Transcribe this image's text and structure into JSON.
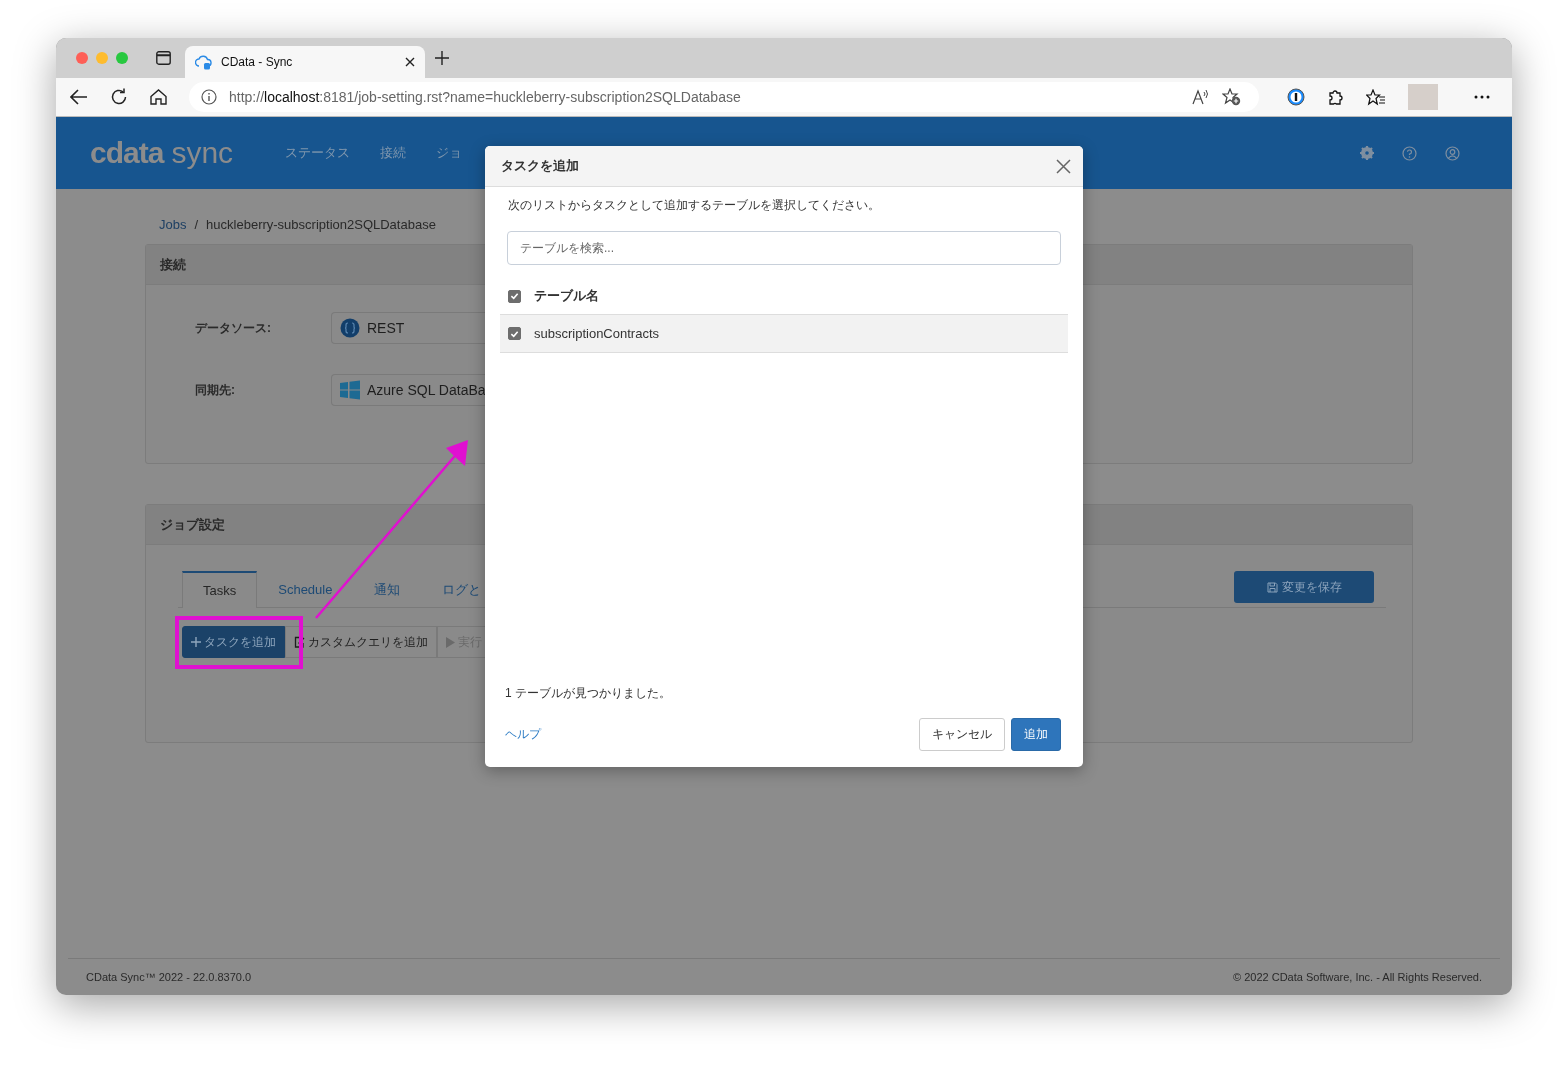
{
  "browser": {
    "tab_title": "CData - Sync",
    "url_scheme": "http://",
    "url_host": "localhost",
    "url_path": ":8181/job-setting.rst?name=huckleberry-subscription2SQLDatabase"
  },
  "app_header": {
    "logo_mark": "cdata",
    "logo_word": "sync",
    "nav": [
      {
        "label": "ステータス"
      },
      {
        "label": "接続"
      },
      {
        "label": "ジョ"
      }
    ]
  },
  "breadcrumb": {
    "link": "Jobs",
    "separator": "/",
    "current": "huckleberry-subscription2SQLDatabase"
  },
  "connection_panel": {
    "title": "接続",
    "fields": [
      {
        "label": "データソース:",
        "value": "REST",
        "kind": "rest"
      },
      {
        "label": "同期先:",
        "value": "Azure SQL DataBa",
        "kind": "windows"
      }
    ]
  },
  "job_panel": {
    "title": "ジョブ設定",
    "tabs": [
      {
        "label": "Tasks",
        "selected": true
      },
      {
        "label": "Schedule",
        "selected": false
      },
      {
        "label": "通知",
        "selected": false
      },
      {
        "label": "ログと",
        "selected": false
      }
    ],
    "save_button": "変更を保存",
    "actions": [
      {
        "label": "タスクを追加",
        "kind": "primary",
        "disabled": false
      },
      {
        "label": "カスタムクエリを追加",
        "kind": "query",
        "disabled": false
      },
      {
        "label": "実行",
        "kind": "run",
        "disabled": true
      }
    ]
  },
  "footer": {
    "version": "CData Sync™ 2022 - 22.0.8370.0",
    "copyright": "© 2022 CData Software, Inc. - All Rights Reserved."
  },
  "dialog": {
    "title": "タスクを追加",
    "instruction": "次のリストからタスクとして追加するテーブルを選択してください。",
    "search": {
      "placeholder": "テーブルを検索..."
    },
    "table": {
      "header": {
        "label": "テーブル名",
        "checked": true
      },
      "rows": [
        {
          "name": "subscriptionContracts",
          "checked": true
        }
      ]
    },
    "result": "1 テーブルが見つかりました。",
    "help_link": "ヘルプ",
    "buttons": [
      {
        "label": "キャンセル",
        "kind": "default"
      },
      {
        "label": "追加",
        "kind": "primary"
      }
    ]
  }
}
